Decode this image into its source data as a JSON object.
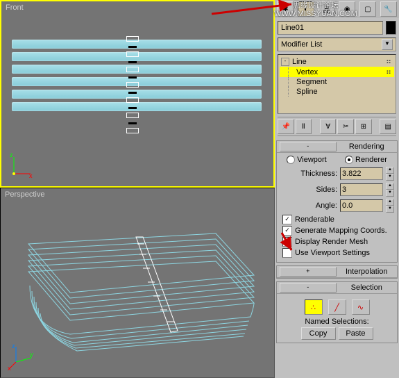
{
  "viewports": {
    "front_label": "Front",
    "persp_label": "Perspective"
  },
  "object_name": "Line01",
  "modifier_combo": "Modifier List",
  "stack": {
    "root": "Line",
    "items": [
      "Vertex",
      "Segment",
      "Spline"
    ],
    "selected": "Vertex"
  },
  "rendering": {
    "title": "Rendering",
    "viewport_label": "Viewport",
    "renderer_label": "Renderer",
    "renderer_on": true,
    "thickness_label": "Thickness:",
    "thickness": "3.822",
    "sides_label": "Sides:",
    "sides": "3",
    "angle_label": "Angle:",
    "angle": "0.0",
    "chk_renderable": "Renderable",
    "chk_mapping": "Generate Mapping Coords.",
    "chk_display": "Display Render Mesh",
    "chk_viewport": "Use Viewport Settings"
  },
  "interpolation_title": "Interpolation",
  "selection": {
    "title": "Selection",
    "named_label": "Named Selections:",
    "copy": "Copy",
    "paste": "Paste"
  },
  "watermark": "思缘设计论坛\nWWW.MISSYUAN.COM"
}
